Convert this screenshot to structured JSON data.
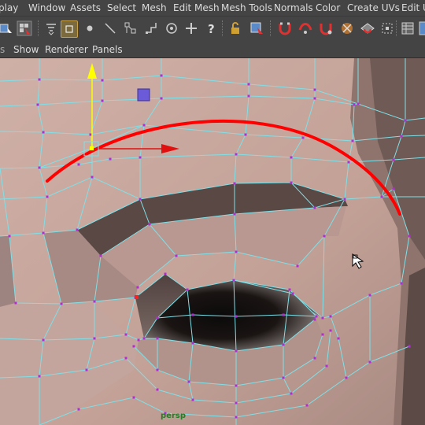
{
  "menubar": {
    "items": [
      {
        "id": "display",
        "label": "play"
      },
      {
        "id": "window",
        "label": "Window"
      },
      {
        "id": "assets",
        "label": "Assets"
      },
      {
        "id": "select",
        "label": "Select"
      },
      {
        "id": "mesh",
        "label": "Mesh"
      },
      {
        "id": "edit_mesh",
        "label": "Edit Mesh"
      },
      {
        "id": "mesh_tools",
        "label": "Mesh Tools"
      },
      {
        "id": "normals",
        "label": "Normals"
      },
      {
        "id": "color",
        "label": "Color"
      },
      {
        "id": "create_uvs",
        "label": "Create UVs"
      },
      {
        "id": "edit_uvs",
        "label": "Edit UV"
      }
    ]
  },
  "toolbar": {
    "tools": [
      {
        "name": "select-by-component-icon"
      },
      {
        "name": "select-by-object-icon"
      },
      {
        "name": "soft-select-icon"
      },
      {
        "name": "rectangle-select-icon"
      },
      {
        "name": "vertex-mode-icon"
      },
      {
        "name": "edge-mode-icon"
      },
      {
        "name": "multi-component-icon"
      },
      {
        "name": "target-weld-icon"
      },
      {
        "name": "move-tool-icon"
      },
      {
        "name": "help-icon"
      },
      {
        "name": "lock-icon"
      },
      {
        "name": "isolate-select-icon"
      },
      {
        "name": "snap-grid-icon"
      },
      {
        "name": "snap-curve-icon"
      },
      {
        "name": "snap-point-icon"
      },
      {
        "name": "snap-view-plane-icon"
      },
      {
        "name": "snap-live-icon"
      },
      {
        "name": "grid-icon"
      },
      {
        "name": "layout-icon"
      },
      {
        "name": "display-icon"
      }
    ],
    "accent": "#c8a04a"
  },
  "panel_menu": {
    "items": [
      {
        "id": "show",
        "label": "Show"
      },
      {
        "id": "renderer",
        "label": "Renderer"
      },
      {
        "id": "panels",
        "label": "Panels"
      }
    ]
  },
  "viewport": {
    "camera_label": "persp",
    "mesh_color": "#c7a59c",
    "wire_color": "#7fe0e8",
    "vertex_color": "#b42bd6",
    "annotation_color": "#ff0000",
    "manipulator": {
      "y_axis_color": "#ffff00",
      "x_axis_color": "#ff0000",
      "plane_handle_color": "#6b5bd8"
    }
  }
}
